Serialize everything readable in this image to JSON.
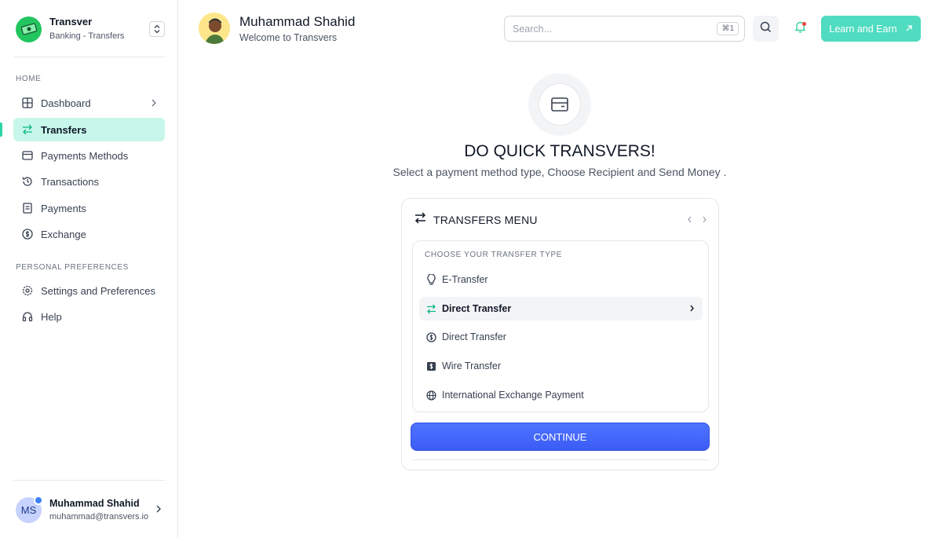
{
  "brand": {
    "name": "Transver",
    "subtitle": "Banking - Transfers"
  },
  "sidebar": {
    "home_label": "HOME",
    "items": [
      {
        "label": "Dashboard",
        "icon": "grid-icon"
      },
      {
        "label": "Transfers",
        "icon": "arrows-swap-icon",
        "active": true
      },
      {
        "label": "Payments Methods",
        "icon": "card-icon"
      },
      {
        "label": "Transactions",
        "icon": "history-icon"
      },
      {
        "label": "Payments",
        "icon": "receipt-icon"
      },
      {
        "label": "Exchange",
        "icon": "dollar-circle-icon"
      }
    ],
    "preferences_label": "PERSONAL PREFERENCES",
    "pref_items": [
      {
        "label": "Settings and Preferences",
        "icon": "gear-icon"
      },
      {
        "label": "Help",
        "icon": "headphones-icon"
      }
    ]
  },
  "user": {
    "initials": "MS",
    "name": "Muhammad Shahid",
    "email": "muhammad@transvers.io"
  },
  "header": {
    "name": "Muhammad Shahid",
    "welcome": "Welcome to Transvers",
    "search_placeholder": "Search...",
    "search_shortcut": "⌘1",
    "cta_label": "Learn and Earn"
  },
  "hero": {
    "title": "DO QUICK TRANSVERS!",
    "subtitle": "Select a payment method type, Choose Recipient and Send Money ."
  },
  "card": {
    "title": "TRANSFERS MENU",
    "type_label": "CHOOSE YOUR TRANSFER TYPE",
    "options": [
      {
        "label": "E-Transfer",
        "icon": "lightbulb-icon"
      },
      {
        "label": "Direct Transfer",
        "icon": "arrows-swap-icon",
        "selected": true
      },
      {
        "label": "Direct Transfer",
        "icon": "dollar-circle-icon"
      },
      {
        "label": "Wire Transfer",
        "icon": "dollar-square-icon"
      },
      {
        "label": "International Exchange Payment",
        "icon": "globe-icon"
      }
    ],
    "continue_label": "CONTINUE"
  },
  "colors": {
    "accent": "#4fdcc0",
    "active_bg": "#c7f7ea",
    "primary": "#3b5cf6"
  }
}
